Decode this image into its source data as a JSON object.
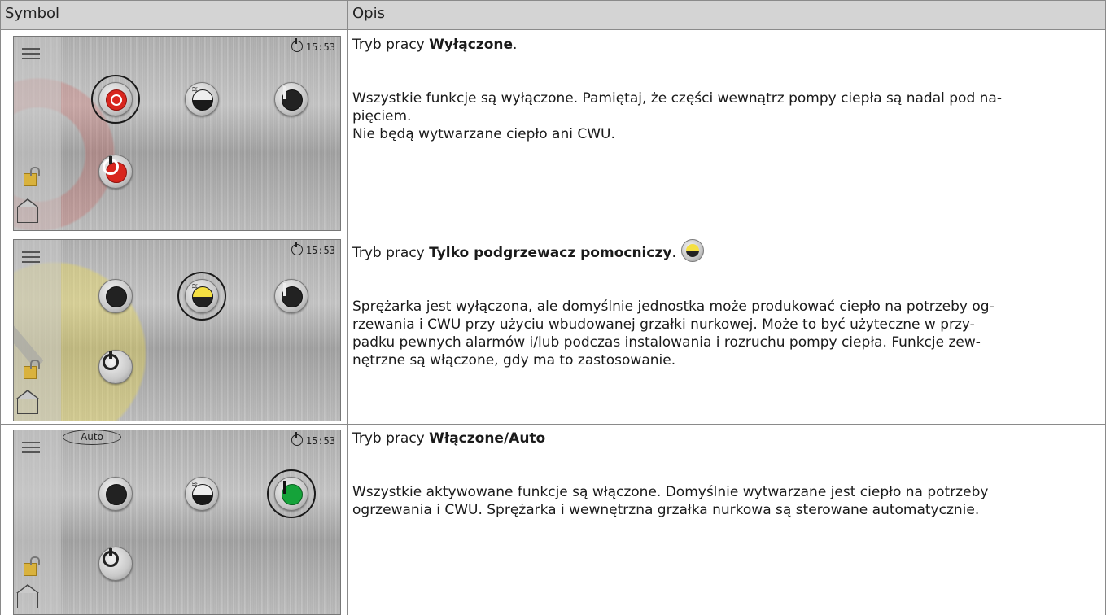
{
  "header": {
    "col1": "Symbol",
    "col2": "Opis"
  },
  "rows": [
    {
      "screen": {
        "clock": "15:53",
        "mode": "off",
        "accent": "#d8261e"
      },
      "title_prefix": "Tryb pracy ",
      "title_bold": "Wyłączone",
      "title_suffix": ".",
      "paragraph1": "Wszystkie funkcje są wyłączone. Pamiętaj, że części wewnątrz pompy ciepła są nadal pod na-",
      "paragraph1b": "pięciem.",
      "paragraph2": "Nie będą wytwarzane ciepło ani CWU."
    },
    {
      "screen": {
        "clock": "15:53",
        "mode": "aux-heater-only",
        "accent": "#f5e042"
      },
      "title_prefix": "Tryb pracy ",
      "title_bold": "Tylko podgrzewacz pomocniczy",
      "title_suffix": ".",
      "paragraph1": "Sprężarka jest wyłączona, ale domyślnie jednostka może produkować ciepło na potrzeby og-",
      "paragraph1b": "rzewania i CWU przy użyciu wbudowanej grzałki nurkowej. Może to być użyteczne w przy-",
      "paragraph2": "padku pewnych alarmów i/lub podczas instalowania i rozruchu pompy ciepła. Funkcje zew-",
      "paragraph3": "nętrzne są włączone, gdy ma to zastosowanie."
    },
    {
      "screen": {
        "clock": "15:53",
        "mode": "on-auto",
        "auto_label": "Auto",
        "accent": "#15a33a"
      },
      "title_prefix": "Tryb pracy ",
      "title_bold": "Włączone/Auto",
      "title_suffix": "",
      "paragraph1": "Wszystkie aktywowane funkcje są włączone. Domyślnie wytwarzane jest ciepło na potrzeby",
      "paragraph1b": "ogrzewania i CWU. Sprężarka i wewnętrzna grzałka nurkowa są sterowane automatycznie."
    }
  ]
}
